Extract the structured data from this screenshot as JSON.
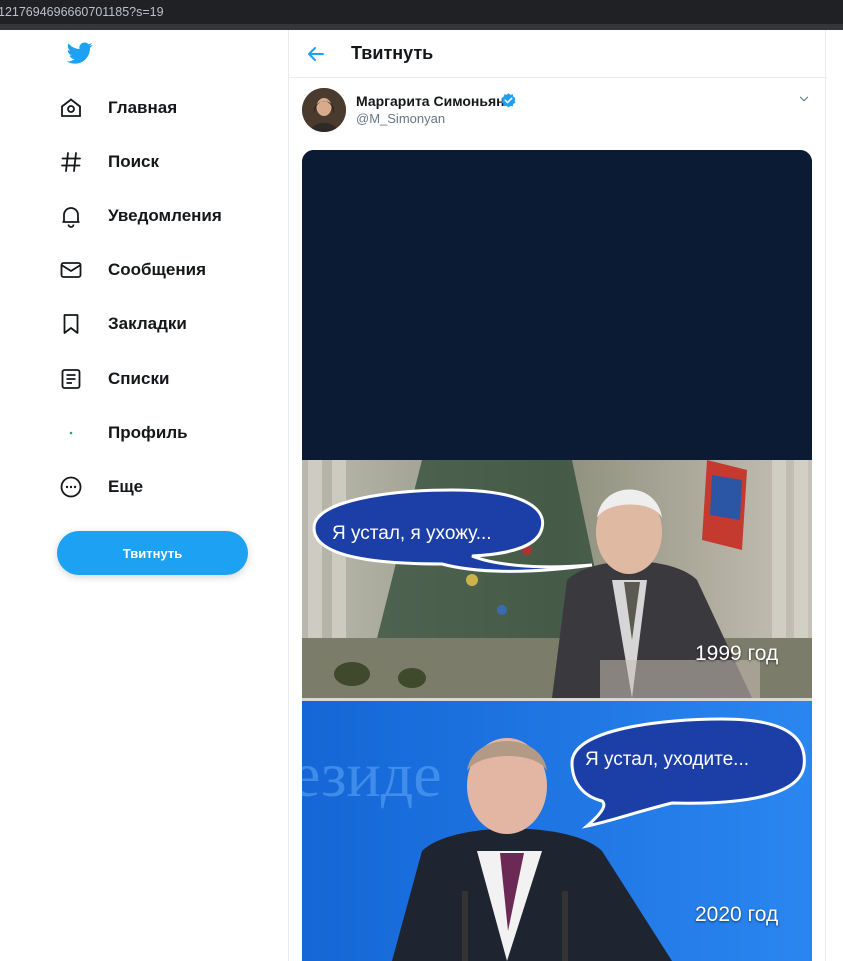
{
  "browser": {
    "url": "1217694696660701185?s=19"
  },
  "sidebar": {
    "items": [
      {
        "label": "Главная",
        "icon": "home-icon"
      },
      {
        "label": "Поиск",
        "icon": "hashtag-icon"
      },
      {
        "label": "Уведомления",
        "icon": "bell-icon"
      },
      {
        "label": "Сообщения",
        "icon": "envelope-icon"
      },
      {
        "label": "Закладки",
        "icon": "bookmark-icon"
      },
      {
        "label": "Списки",
        "icon": "list-icon"
      },
      {
        "label": "Профиль",
        "icon": "profile-icon"
      },
      {
        "label": "Еще",
        "icon": "more-icon"
      }
    ],
    "tweet_button": "Твитнуть"
  },
  "main": {
    "header_title": "Твитнуть",
    "tweet": {
      "author_name": "Маргарита Симоньян",
      "handle": "@M_Simonyan",
      "verified": true,
      "media": {
        "panel1_bubble": "Я устал, я ухожу...",
        "panel1_year": "1999 год",
        "panel2_bubble": "Я устал, уходите...",
        "panel2_year": "2020 год"
      }
    }
  },
  "colors": {
    "accent": "#1da1f2",
    "text": "#14171a",
    "muted": "#657786",
    "border": "#e6ecf0"
  }
}
